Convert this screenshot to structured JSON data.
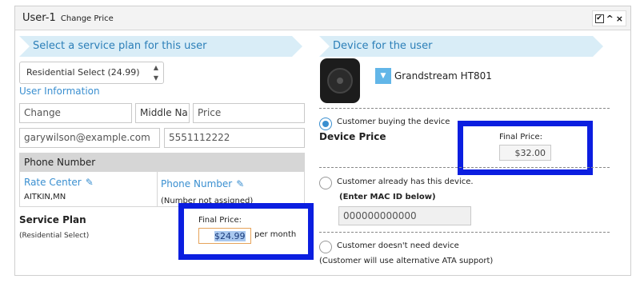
{
  "header": {
    "title": "User-1",
    "subtitle": "Change Price",
    "check_glyph": "✔",
    "collapse_glyph": "^",
    "close_glyph": "×"
  },
  "left": {
    "ribbon": "Select a service plan for this user",
    "plan_select": "Residential Select (24.99)",
    "user_info_link": "User Information",
    "first_name": "Change",
    "middle_name_placeholder": "Middle Na",
    "last_name": "Price",
    "email": "garywilson@example.com",
    "phone": "5551112222",
    "phone_section": "Phone Number",
    "rate_center_label": "Rate Center",
    "rate_center_value": "AITKIN,MN",
    "phone_number_label": "Phone Number",
    "phone_number_value": "(Number not assigned)",
    "service_plan_title": "Service Plan",
    "service_plan_sub": "(Residential Select)",
    "final_price_label": "Final Price:",
    "final_price_value": "$24.99",
    "per_month": "per month"
  },
  "right": {
    "ribbon": "Device for the user",
    "device_name": "Grandstream HT801",
    "opt_buying": "Customer buying the device",
    "device_price_title": "Device Price",
    "device_final_label": "Final Price:",
    "device_final_value": "$32.00",
    "opt_has_device": "Customer already has this device.",
    "mac_label": "(Enter MAC ID below)",
    "mac_value": "000000000000",
    "opt_no_device": "Customer doesn't need device",
    "opt_no_device_note": "(Customer will use alternative ATA support)"
  },
  "colors": {
    "highlight_border": "#0b1ee0",
    "ribbon_bg": "#d9edf7",
    "link_blue": "#3a8fd0"
  }
}
